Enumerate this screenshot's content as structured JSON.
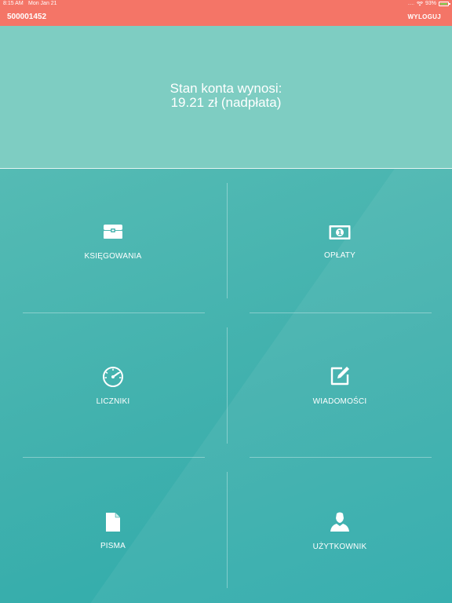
{
  "status_bar": {
    "time": "8:15 AM",
    "date": "Mon Jan 21",
    "signal": ".....",
    "battery": "93%",
    "icons": [
      "wifi-icon",
      "battery-icon"
    ]
  },
  "header": {
    "account_id": "500001452",
    "logout_label": "WYLOGUJ",
    "color": "#f47567"
  },
  "balance": {
    "label": "Stan konta wynosi:",
    "value": "19.21 zł (nadpłata)",
    "color": "#7ecdc2"
  },
  "menu": {
    "items": [
      {
        "label": "KSIĘGOWANIA",
        "icon": "chest-icon"
      },
      {
        "label": "OPŁATY",
        "icon": "banknote-icon"
      },
      {
        "label": "LICZNIKI",
        "icon": "gauge-icon"
      },
      {
        "label": "WIADOMOŚCI",
        "icon": "edit-icon"
      },
      {
        "label": "PISMA",
        "icon": "document-icon"
      },
      {
        "label": "UŻYTKOWNIK",
        "icon": "user-icon"
      }
    ],
    "color": "#3fb0ad"
  }
}
